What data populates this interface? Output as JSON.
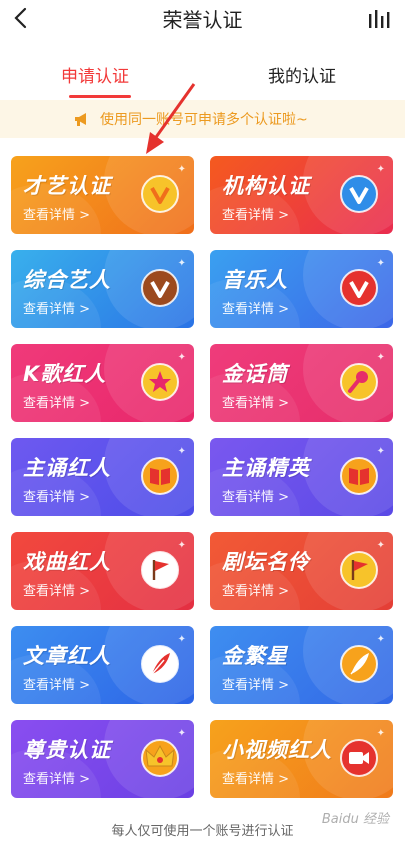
{
  "header": {
    "title": "荣誉认证"
  },
  "tabs": [
    {
      "label": "申请认证",
      "active": true
    },
    {
      "label": "我的认证",
      "active": false
    }
  ],
  "notice": {
    "text": "使用同一账号可申请多个认证啦~"
  },
  "detail_label": "查看详情 >",
  "cards": [
    {
      "name": "才艺认证",
      "icon": "v-badge-icon",
      "colors": [
        "#f7a21c",
        "#f06e1b"
      ],
      "badge": "#f7c32a",
      "mark": "#f06e1b"
    },
    {
      "name": "机构认证",
      "icon": "v-badge-icon",
      "colors": [
        "#f55a1f",
        "#e92c4f"
      ],
      "badge": "#2f8de8",
      "mark": "#ffffff"
    },
    {
      "name": "综合艺人",
      "icon": "v-badge-icon",
      "colors": [
        "#39b0ec",
        "#2a73e6"
      ],
      "badge": "#9c4a1e",
      "mark": "#ffffff"
    },
    {
      "name": "音乐人",
      "icon": "v-badge-icon",
      "colors": [
        "#3aa0f0",
        "#3c66e8"
      ],
      "badge": "#e5322e",
      "mark": "#ffffff"
    },
    {
      "name": "K歌红人",
      "icon": "star-icon",
      "colors": [
        "#f03a7a",
        "#e8266a"
      ],
      "badge": "#f7c32a",
      "mark": "#e8266a"
    },
    {
      "name": "金话筒",
      "icon": "microphone-icon",
      "colors": [
        "#ef3c7b",
        "#e62d6a"
      ],
      "badge": "#f7c32a",
      "mark": "#e62d6a"
    },
    {
      "name": "主诵红人",
      "icon": "book-icon",
      "colors": [
        "#6e59f0",
        "#4c4ce8"
      ],
      "badge": "#f7a21c",
      "mark": "#e5322e"
    },
    {
      "name": "主诵精英",
      "icon": "book-icon",
      "colors": [
        "#7a58ef",
        "#5a49e6"
      ],
      "badge": "#f7a21c",
      "mark": "#e5322e"
    },
    {
      "name": "戏曲红人",
      "icon": "flag-icon",
      "colors": [
        "#f2493e",
        "#e42f42"
      ],
      "badge": "#ffffff",
      "mark": "#e5322e"
    },
    {
      "name": "剧坛名伶",
      "icon": "flag-icon",
      "colors": [
        "#f25a36",
        "#e43e36"
      ],
      "badge": "#f7c32a",
      "mark": "#e5322e"
    },
    {
      "name": "文章红人",
      "icon": "feather-icon",
      "colors": [
        "#3d8ef0",
        "#2c63e6"
      ],
      "badge": "#ffffff",
      "mark": "#e5322e"
    },
    {
      "name": "金繁星",
      "icon": "feather-icon",
      "colors": [
        "#3e8ef0",
        "#3368e6"
      ],
      "badge": "#f7a21c",
      "mark": "#ffffff"
    },
    {
      "name": "尊贵认证",
      "icon": "crown-icon",
      "colors": [
        "#8a4ef0",
        "#6a40e4"
      ],
      "badge": "#f7a21c",
      "mark": "#e5322e"
    },
    {
      "name": "小视频红人",
      "icon": "video-icon",
      "colors": [
        "#f7a21c",
        "#f07a1b"
      ],
      "badge": "#e5322e",
      "mark": "#ffffff"
    }
  ],
  "footer": {
    "text": "每人仅可使用一个账号进行认证"
  },
  "watermark": {
    "text": "Baidu 经验"
  }
}
